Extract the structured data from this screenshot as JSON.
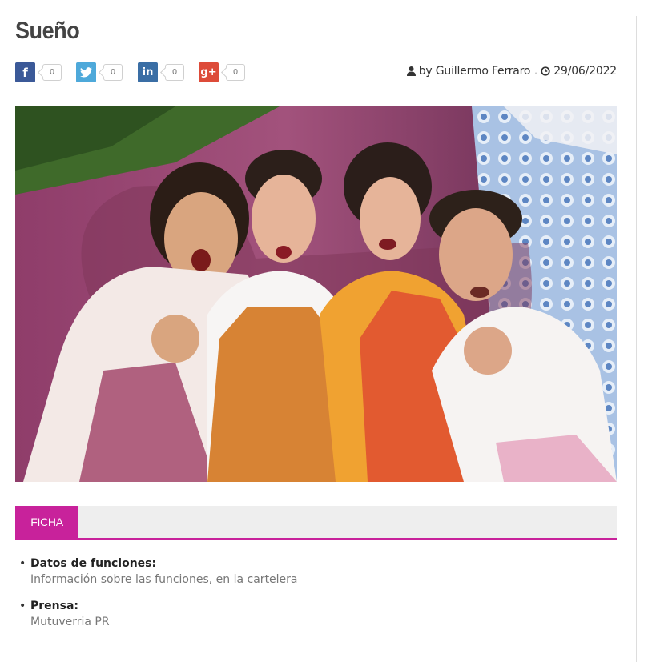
{
  "article": {
    "title": "Sueño",
    "author_line": "by Guillermo Ferraro",
    "date": "29/06/2022"
  },
  "share": [
    {
      "network": "facebook",
      "icon": "facebook-icon",
      "glyph": "f",
      "color": "#3b5998",
      "count": "0"
    },
    {
      "network": "twitter",
      "icon": "twitter-icon",
      "glyph": "",
      "color": "#4ea9da",
      "count": "0"
    },
    {
      "network": "linkedin",
      "icon": "linkedin-icon",
      "glyph": "in",
      "color": "#3a6ea5",
      "count": "0"
    },
    {
      "network": "google-plus",
      "icon": "google-plus-icon",
      "glyph": "g+",
      "color": "#dd4b39",
      "count": "0"
    }
  ],
  "tabs": {
    "ficha_label": "FICHA",
    "accent_color": "#c8229b"
  },
  "ficha": [
    {
      "label": "Datos de funciones:",
      "value": "Información sobre las funciones, en la cartelera"
    },
    {
      "label": "Prensa:",
      "value": "Mutuverria PR"
    }
  ]
}
